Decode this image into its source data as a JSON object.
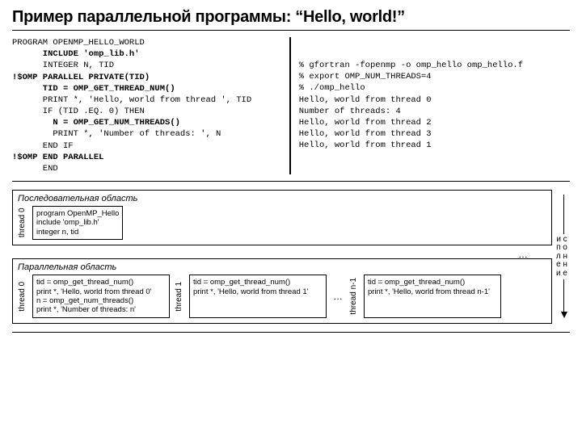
{
  "title": "Пример параллельной программы: “Hello, world!”",
  "code": {
    "l1": "PROGRAM OPENMP_HELLO_WORLD",
    "l2": "      INCLUDE 'omp_lib.h'",
    "l3": "      INTEGER N, TID",
    "l4": "!$OMP PARALLEL PRIVATE(TID)",
    "l5": "      TID = OMP_GET_THREAD_NUM()",
    "l6": "      PRINT *, 'Hello, world from thread ', TID",
    "l7": "      IF (TID .EQ. 0) THEN",
    "l8": "        N = OMP_GET_NUM_THREADS()",
    "l9": "        PRINT *, 'Number of threads: ', N",
    "l10": "      END IF",
    "l11": "!$OMP END PARALLEL",
    "l12": "      END"
  },
  "term": {
    "l1": "% gfortran -fopenmp -o omp_hello omp_hello.f",
    "l2": "% export OMP_NUM_THREADS=4",
    "l3": "% ./omp_hello",
    "l4": "Hello, world from thread 0",
    "l5": "Number of threads: 4",
    "l6": "Hello, world from thread 2",
    "l7": "Hello, world from thread 3",
    "l8": "Hello, world from thread 1"
  },
  "diagram": {
    "seq_title": "Последовательная область",
    "par_title": "Параллельная область",
    "exec_label": "и\nс\nп\nо\nл\nн\nе\nн\nи\nе",
    "seq": {
      "thread_label": "thread 0",
      "body": "program OpenMP_Hello\ninclude 'omp_lib.h'\ninteger n, tid"
    },
    "par": {
      "t0": {
        "label": "thread 0",
        "body": "tid = omp_get_thread_num()\nprint *, 'Hello, world from thread 0'\nn = omp_get_num_threads()\nprint *, 'Number of threads: n'"
      },
      "t1": {
        "label": "thread 1",
        "body": "tid = omp_get_thread_num()\nprint *, 'Hello, world from thread 1'"
      },
      "dots": "…",
      "tn": {
        "label": "thread n-1",
        "body": "tid = omp_get_thread_num()\nprint *, 'Hello, world from thread n-1'"
      }
    }
  }
}
